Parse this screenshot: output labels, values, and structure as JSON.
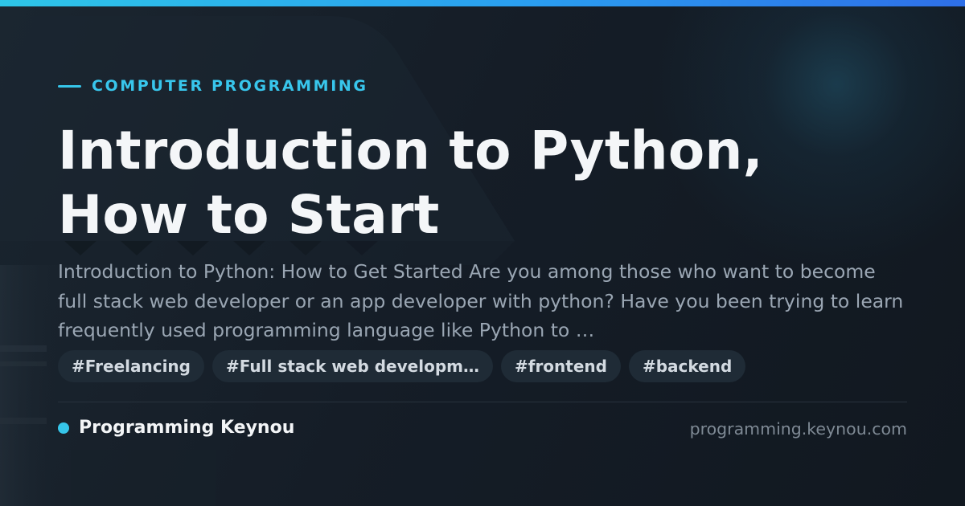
{
  "colors": {
    "accent": "#36c6ea",
    "background": "#111821",
    "title": "#f4f6f8",
    "description": "#9aa6b3",
    "tag_background": "#1f2b36",
    "tag_text": "#d3dae1",
    "domain": "#7e8994"
  },
  "header": {
    "category": "COMPUTER PROGRAMMING"
  },
  "article": {
    "title": "Introduction to Python, How to Start",
    "description": "Introduction to Python: How to Get Started Are you among those who want to become full stack web developer or an app developer with python? Have you been trying to learn frequently used programming language like Python to …"
  },
  "tags": [
    {
      "label": "#Freelancing"
    },
    {
      "label": "#Full stack web developm…"
    },
    {
      "label": "#frontend"
    },
    {
      "label": "#backend"
    }
  ],
  "footer": {
    "brand_icon": "dot-icon",
    "brand_name": "Programming Keynou",
    "domain": "programming.keynou.com"
  }
}
